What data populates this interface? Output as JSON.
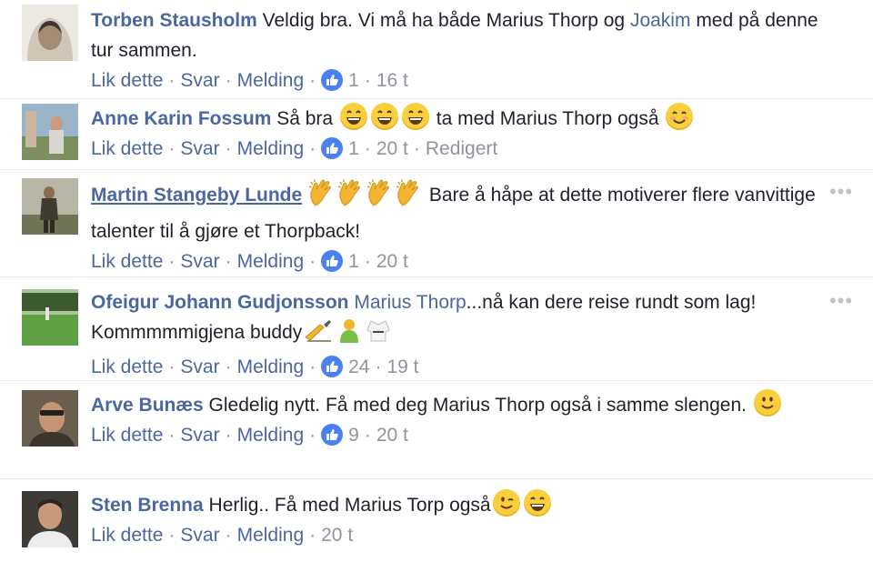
{
  "actions": {
    "like": "Lik dette",
    "reply": "Svar",
    "message": "Melding",
    "sep": "·"
  },
  "colors": {
    "link": "#4b67a1",
    "meta": "#90949c",
    "like_badge": "#4a80f0",
    "emoji": "#f9cf3d"
  },
  "comments": [
    {
      "author": "Torben Stausholm",
      "text_1": "Veldig bra. Vi må ha både Marius Thorp og ",
      "mention": "Joakim",
      "text_2": " med på denne tur sammen.",
      "likes": "1",
      "time": "16 t"
    },
    {
      "author": "Anne Karin Fossum",
      "text_1": "Så bra ",
      "emojis_1": [
        "grinning-face-icon",
        "grinning-face-icon",
        "grinning-face-icon"
      ],
      "text_2": " ta med Marius Thorp også ",
      "emojis_2": [
        "smiling-face-icon"
      ],
      "likes": "1",
      "time": "20 t",
      "edited": "Redigert"
    },
    {
      "author": "Martin Stangeby Lunde",
      "emojis_1": [
        "clapping-hands-icon",
        "clapping-hands-icon",
        "clapping-hands-icon",
        "clapping-hands-icon"
      ],
      "text_1": " Bare å håpe at dette motiverer flere vanvittige talenter til å gjøre et Thorpback!",
      "likes": "1",
      "time": "20 t"
    },
    {
      "author": "Ofeigur Johann Gudjonsson",
      "mention": "Marius Thorp",
      "text_1": "...nå kan dere reise rundt som lag! Kommmmmigjena buddy",
      "emojis_1": [
        "writing-hand-icon",
        "person-icon",
        "martial-arts-uniform-icon"
      ],
      "likes": "24",
      "time": "19 t"
    },
    {
      "author": "Arve Bunæs",
      "text_1": "Gledelig nytt. Få med deg Marius Thorp også i samme slengen.",
      "emojis_1": [
        "slightly-smiling-face-icon"
      ],
      "likes": "9",
      "time": "20 t"
    },
    {
      "author": "Sten Brenna",
      "text_1": "Herlig.. Få med Marius Torp også",
      "emojis_1": [
        "winking-face-icon",
        "grinning-face-icon"
      ],
      "time": "20 t"
    }
  ]
}
